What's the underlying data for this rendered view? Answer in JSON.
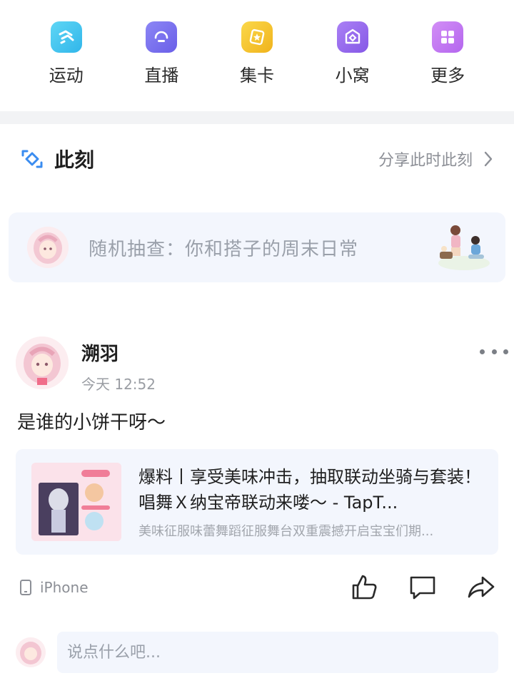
{
  "quick_nav": [
    {
      "label": "运动",
      "icon": "sport-icon",
      "color": "#43c7ee"
    },
    {
      "label": "直播",
      "icon": "live-icon",
      "color": "#7a72f0"
    },
    {
      "label": "集卡",
      "icon": "card-collect-icon",
      "color": "#f6c32d"
    },
    {
      "label": "小窝",
      "icon": "home-icon",
      "color": "#9a6ff0"
    },
    {
      "label": "更多",
      "icon": "grid-icon",
      "color": "#c57bf0"
    }
  ],
  "moment": {
    "title": "此刻",
    "share_label": "分享此时此刻",
    "accent": "#3a8cf0"
  },
  "prompt_card": {
    "text": "随机抽查：你和搭子的周末日常"
  },
  "post": {
    "author": "溯羽",
    "time": "今天 12:52",
    "text": "是谁的小饼干呀～",
    "link": {
      "title": "爆料丨享受美味冲击，抽取联动坐骑与套装！唱舞Ｘ纳宝帝联动来喽～ - TapT...",
      "desc": "美味征服味蕾舞蹈征服舞台双重震撼开启宝宝们期..."
    },
    "device": "iPhone"
  },
  "comment": {
    "placeholder": "说点什么吧..."
  }
}
